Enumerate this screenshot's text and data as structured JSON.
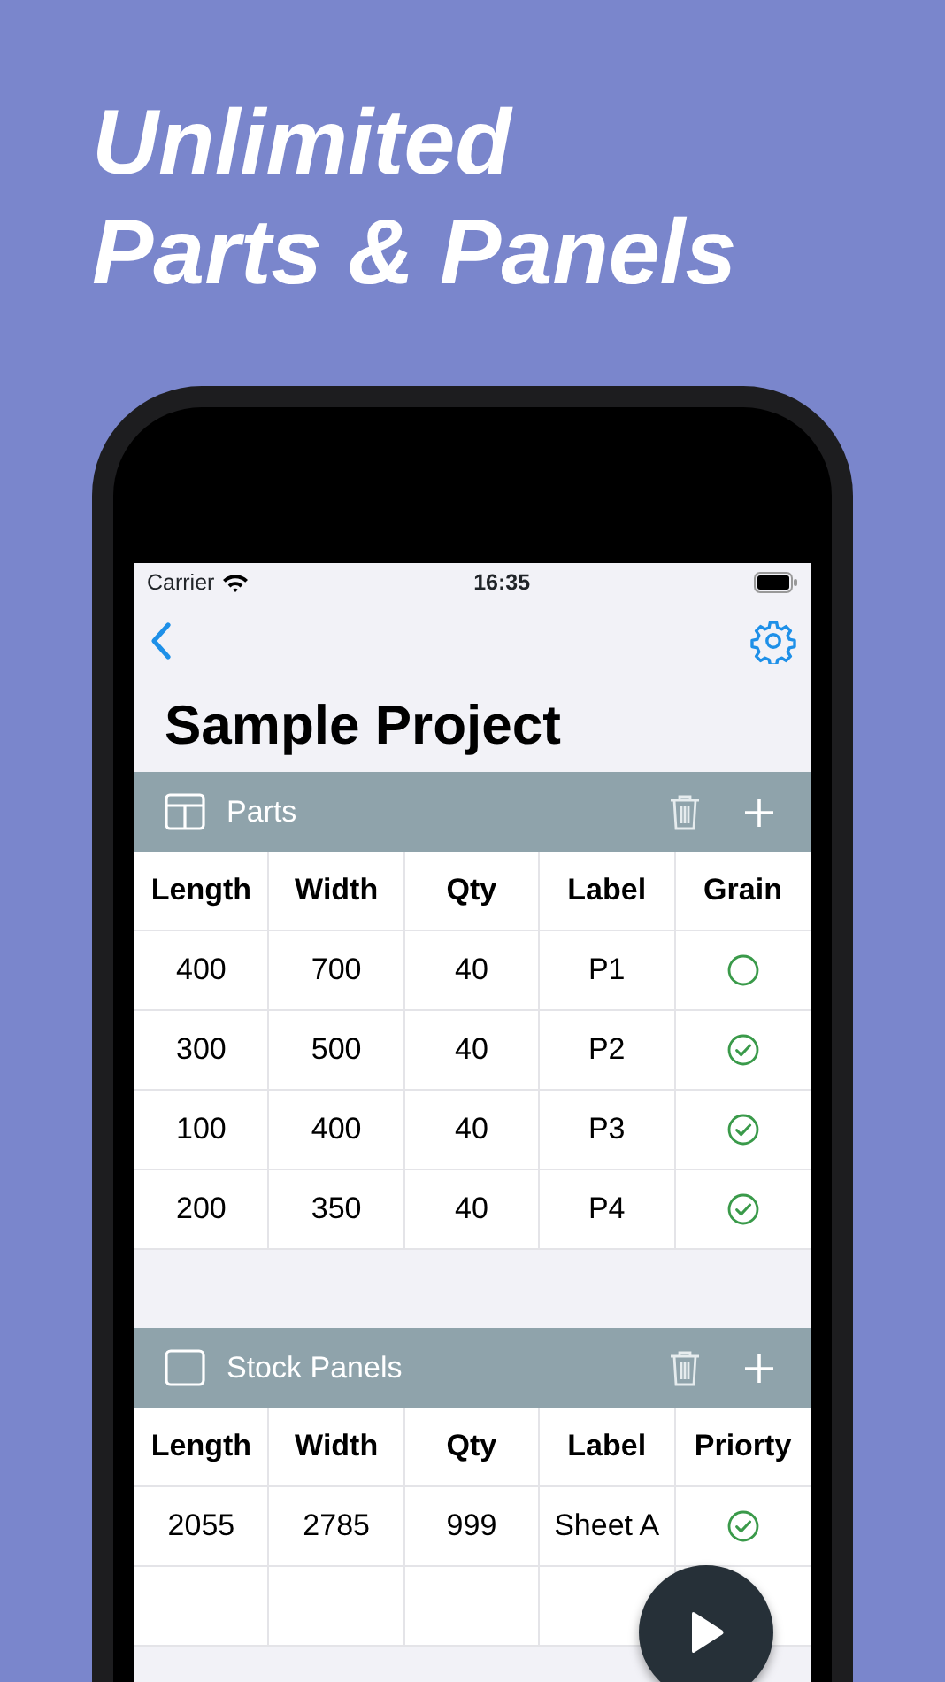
{
  "headline": [
    "Unlimited",
    "Parts & Panels"
  ],
  "status_bar": {
    "carrier": "Carrier",
    "time": "16:35"
  },
  "title": "Sample Project",
  "sections": [
    {
      "title": "Parts",
      "kind": "parts",
      "columns": [
        "Length",
        "Width",
        "Qty",
        "Label",
        "Grain"
      ],
      "rows": [
        {
          "cells": [
            "400",
            "700",
            "40",
            "P1"
          ],
          "checked": false
        },
        {
          "cells": [
            "300",
            "500",
            "40",
            "P2"
          ],
          "checked": true
        },
        {
          "cells": [
            "100",
            "400",
            "40",
            "P3"
          ],
          "checked": true
        },
        {
          "cells": [
            "200",
            "350",
            "40",
            "P4"
          ],
          "checked": true
        }
      ]
    },
    {
      "title": "Stock Panels",
      "kind": "stock",
      "blank_row": true,
      "columns": [
        "Length",
        "Width",
        "Qty",
        "Label",
        "Priorty"
      ],
      "rows": [
        {
          "cells": [
            "2055",
            "2785",
            "999",
            "Sheet A"
          ],
          "checked": true
        }
      ]
    }
  ]
}
